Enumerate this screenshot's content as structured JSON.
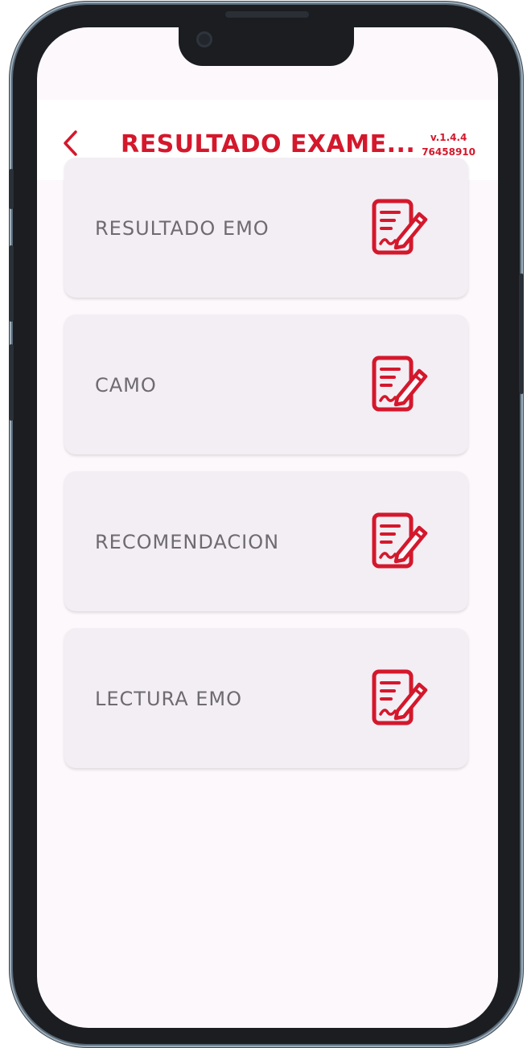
{
  "header": {
    "back_icon": "chevron-left-icon",
    "title": "RESULTADO EXAME...",
    "version": "v.1.4.4",
    "user_code": "76458910",
    "accent_color": "#d4182c"
  },
  "menu": {
    "items": [
      {
        "label": "RESULTADO EMO",
        "icon": "document-edit-icon"
      },
      {
        "label": "CAMO",
        "icon": "document-edit-icon"
      },
      {
        "label": "RECOMENDACION",
        "icon": "document-edit-icon"
      },
      {
        "label": "LECTURA EMO",
        "icon": "document-edit-icon"
      }
    ]
  }
}
